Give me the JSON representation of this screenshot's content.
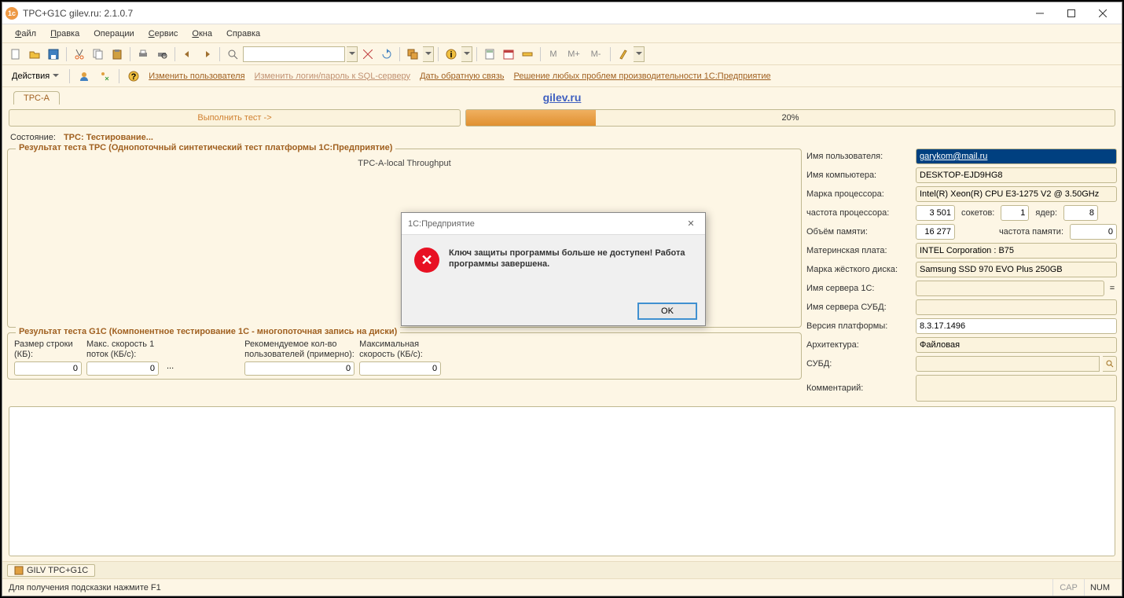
{
  "window": {
    "title": "TPC+G1C gilev.ru: 2.1.0.7",
    "app_icon": "1c"
  },
  "menu": {
    "file": "Файл",
    "edit": "Правка",
    "ops": "Операции",
    "service": "Сервис",
    "windows": "Окна",
    "help": "Справка"
  },
  "toolbar1": {
    "m": "M",
    "mplus": "M+",
    "mminus": "M-"
  },
  "toolbar2": {
    "actions": "Действия",
    "change_user": "Изменить пользователя",
    "change_sql": "Изменить логин/пароль к SQL-серверу",
    "feedback": "Дать обратную связь",
    "solve": "Решение любых проблем производительности 1С:Предприятие"
  },
  "tab": {
    "name": "TPC-A"
  },
  "gilev_link": "gilev.ru",
  "run_button": "Выполнить тест ->",
  "progress": {
    "percent": "20%"
  },
  "status": {
    "label": "Состояние:",
    "value": "TPC: Тестирование..."
  },
  "tpc": {
    "legend": "Результат теста TPC (Однопоточный синтетический тест платформы 1С:Предприятие)",
    "chart_label": "TPC-A-local Throughput"
  },
  "g1c": {
    "legend": "Результат теста G1C (Компонентное тестирование 1С - многопоточная запись на диски)",
    "col1_label": "Размер строки (КБ):",
    "col2_label": "Макс. скорость 1 поток (КБ/c):",
    "col3_label": "Рекомендуемое кол-во пользователей (примерно):",
    "col4_label": "Максимальная скорость (КБ/c):",
    "v1": "0",
    "v2": "0",
    "v3": "0",
    "v4": "0",
    "ellipsis": "..."
  },
  "form": {
    "user_label": "Имя пользователя:",
    "user_value": "garykom@mail.ru",
    "comp_label": "Имя компьютера:",
    "comp_value": "DESKTOP-EJD9HG8",
    "cpu_label": "Марка процессора:",
    "cpu_value": "Intel(R) Xeon(R) CPU E3-1275 V2 @ 3.50GHz",
    "freq_label": "частота процессора:",
    "freq_value": "3 501",
    "sockets_label": "сокетов:",
    "sockets_value": "1",
    "cores_label": "ядер:",
    "cores_value": "8",
    "mem_label": "Объём памяти:",
    "mem_value": "16 277",
    "memfreq_label": "частота памяти:",
    "memfreq_value": "0",
    "mb_label": "Материнская плата:",
    "mb_value": "INTEL Corporation : B75",
    "hdd_label": "Марка жёсткого диска:",
    "hdd_value": "Samsung SSD 970 EVO Plus 250GB",
    "srv1c_label": "Имя сервера 1C:",
    "srv1c_value": "",
    "srvdb_label": "Имя сервера СУБД:",
    "srvdb_value": "",
    "ver_label": "Версия платформы:",
    "ver_value": "8.3.17.1496",
    "arch_label": "Архитектура:",
    "arch_value": "Файловая",
    "subd_label": "СУБД:",
    "subd_value": "",
    "comment_label": "Комментарий:",
    "comment_value": "",
    "eq": "="
  },
  "modal": {
    "title": "1С:Предприятие",
    "text": "Ключ защиты программы больше не доступен! Работа программы завершена.",
    "ok": "OK"
  },
  "docbar": {
    "tab": "GILV TPC+G1C"
  },
  "statusbar": {
    "hint": "Для получения подсказки нажмите F1",
    "cap": "CAP",
    "num": "NUM"
  }
}
